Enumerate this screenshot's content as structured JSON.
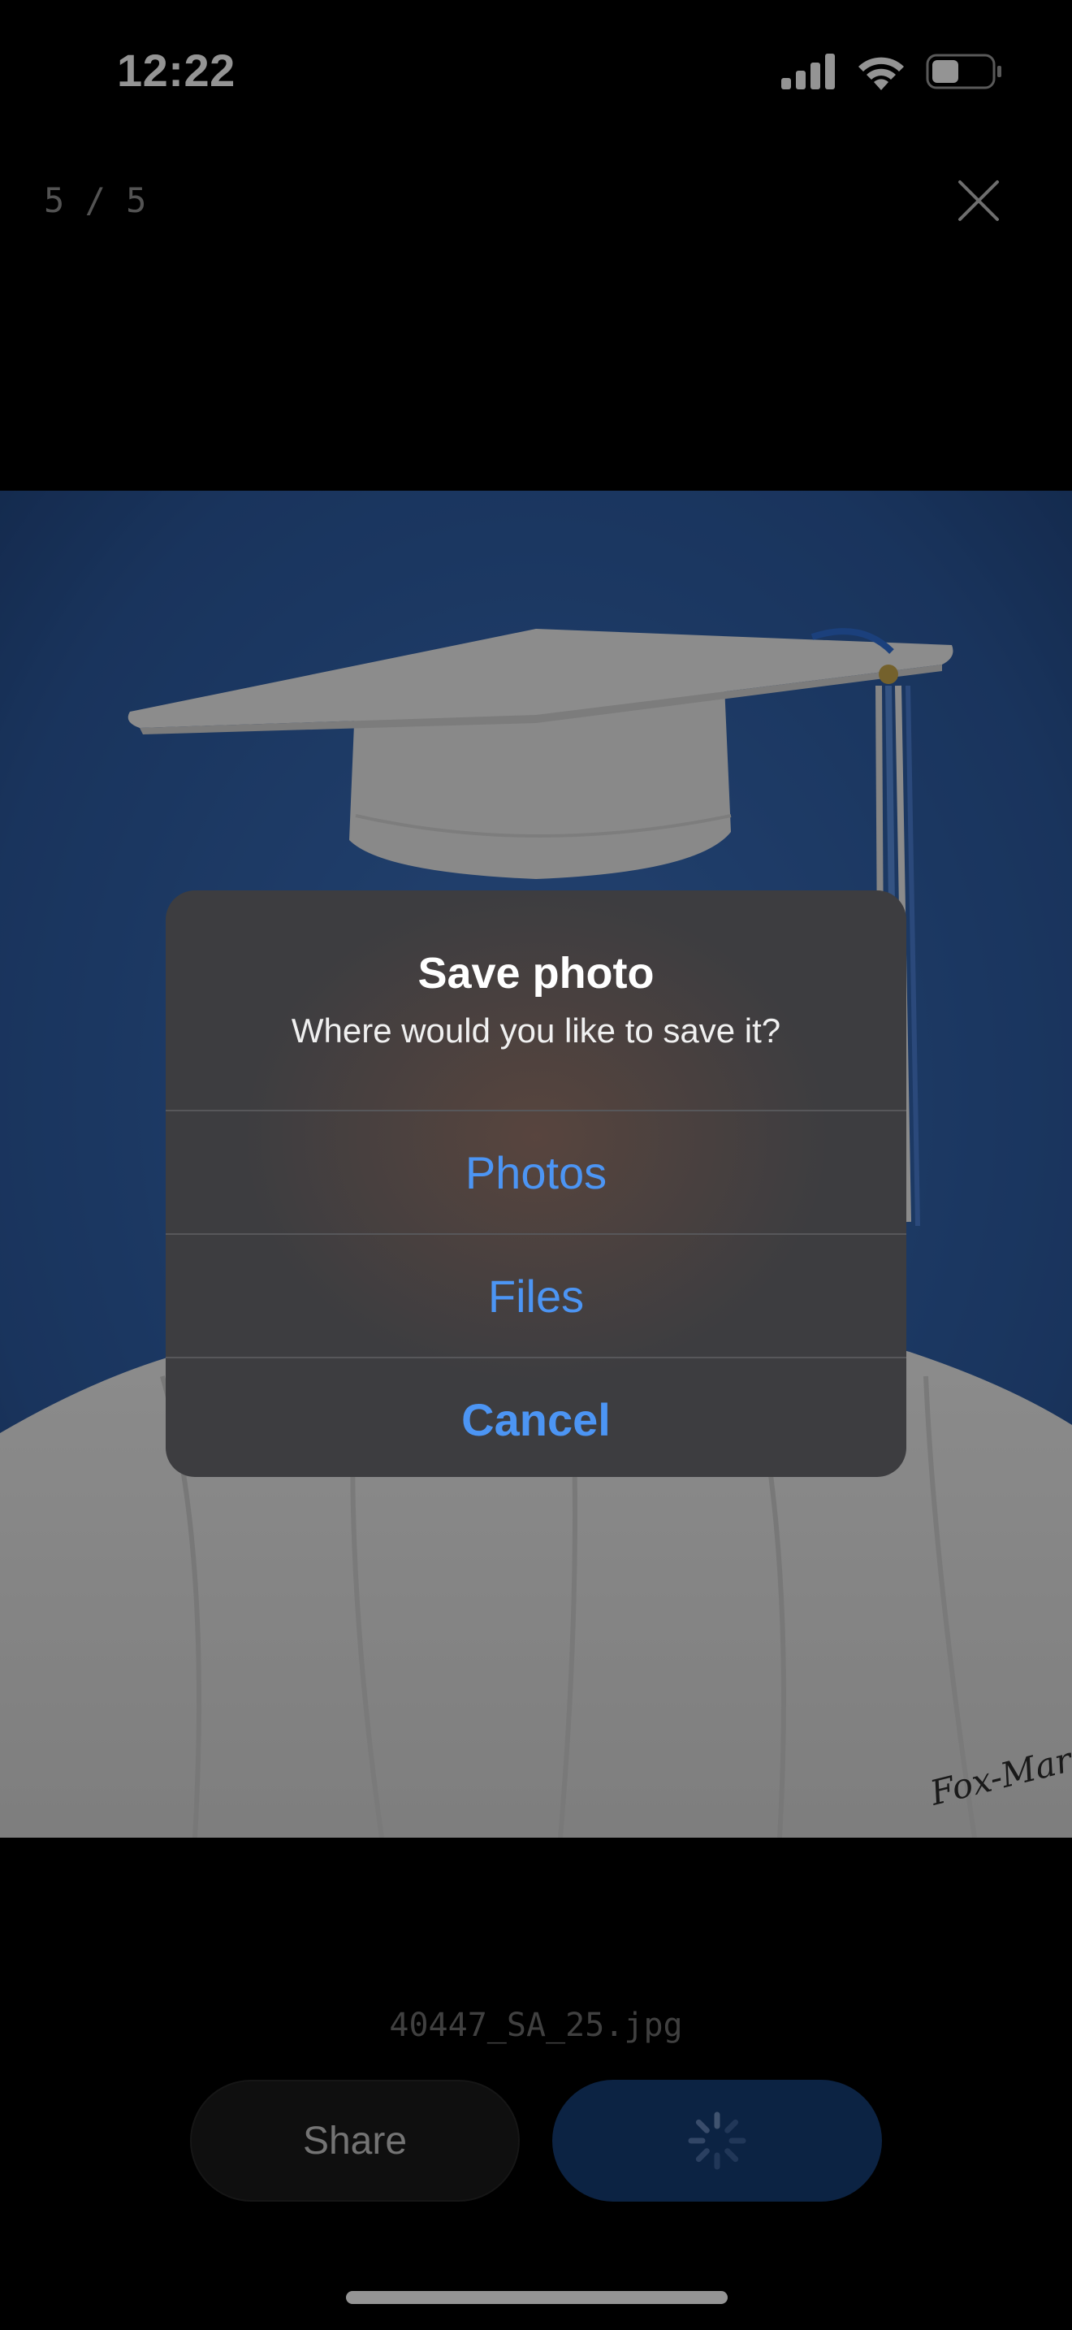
{
  "status_bar": {
    "time": "12:22"
  },
  "viewer": {
    "counter": "5 / 5",
    "filename": "40447_SA_25.jpg",
    "photo_signature": "Fox-Mar"
  },
  "actions": {
    "share_label": "Share"
  },
  "dialog": {
    "title": "Save photo",
    "message": "Where would you like to save it?",
    "options": [
      {
        "label": "Photos"
      },
      {
        "label": "Files"
      },
      {
        "label": "Cancel"
      }
    ]
  },
  "colors": {
    "accent": "#4c95f4",
    "photo_background": "#2c5aa0",
    "save_button": "#163d74"
  },
  "icons": [
    "cellular-signal-icon",
    "wifi-icon",
    "battery-icon",
    "close-icon",
    "spinner-icon"
  ]
}
